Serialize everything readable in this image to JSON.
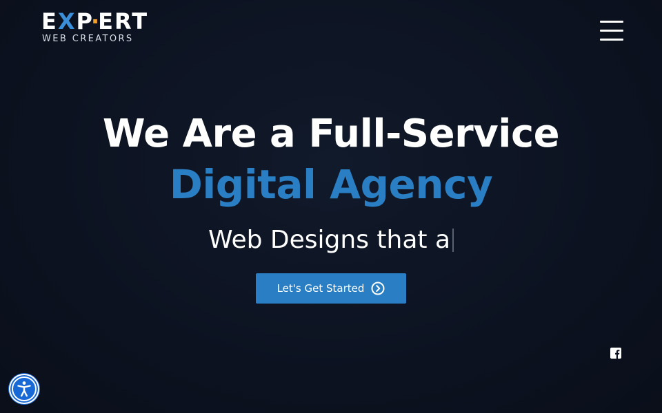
{
  "brand": {
    "logo_main": "EXPERT",
    "logo_sub": "WEB CREATORS",
    "accent_color": "#2a7fc4",
    "logo_x_color": "#3b8fd8",
    "logo_dot_color": "#f0a028"
  },
  "header": {
    "menu_icon": "hamburger-menu-icon"
  },
  "hero": {
    "title_line1": "We Are a Full-Service",
    "title_line2": "Digital Agency",
    "typing_text": "Web Designs that a",
    "cta_label": "Let's Get Started",
    "cta_icon": "chevron-right-circle-icon"
  },
  "social": {
    "facebook_icon": "facebook-icon"
  },
  "accessibility": {
    "icon": "accessibility-icon",
    "color": "#1769d6"
  }
}
